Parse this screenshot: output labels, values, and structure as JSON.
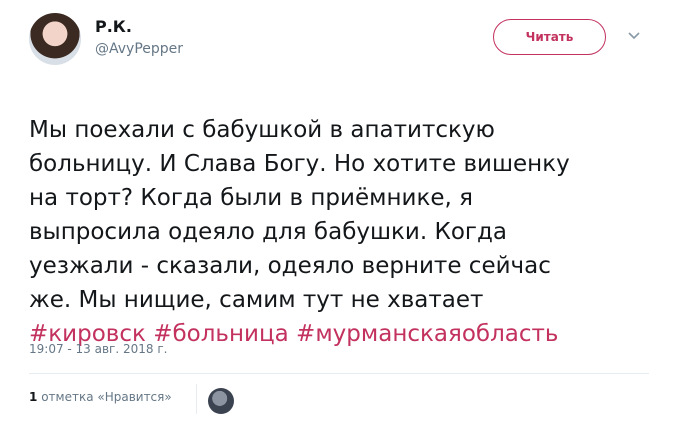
{
  "user": {
    "display_name": "Р.К.",
    "handle": "@AvyPepper"
  },
  "follow_button": {
    "label": "Читать"
  },
  "tweet": {
    "lines": [
      "Мы поехали с бабушкой в апатитскую",
      "больницу. И Слава Богу. Но хотите вишенку",
      "на торт? Когда были в приёмнике, я",
      "выпросила одеяло для бабушки. Когда",
      "уезжали - сказали, одеяло верните сейчас",
      "же. Мы нищие, самим тут не хватает"
    ],
    "hashtags": [
      "#кировск",
      "#больница",
      "#мурманскаяобласть"
    ],
    "timestamp": "19:07 - 13 авг. 2018 г."
  },
  "likes": {
    "count": "1",
    "label": "отметка «Нравится»"
  },
  "colors": {
    "accent": "#c3325f",
    "muted": "#657786",
    "text": "#14171a"
  },
  "icons": {
    "caret": "chevron-down-icon"
  }
}
